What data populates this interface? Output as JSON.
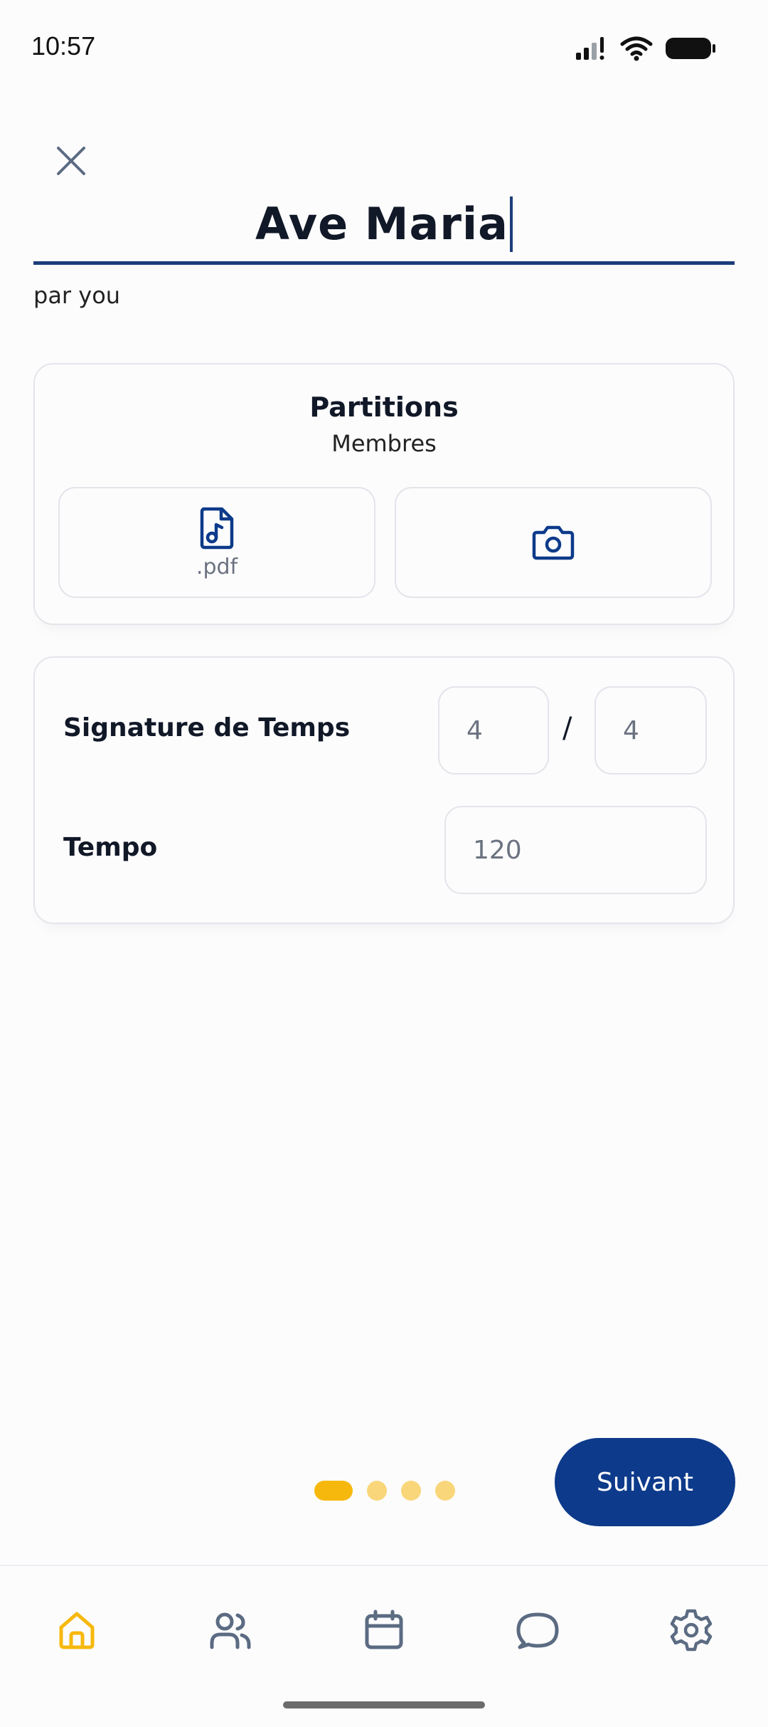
{
  "status_bar": {
    "time": "10:57"
  },
  "header": {
    "title_value": "Ave Maria",
    "author": "par you"
  },
  "sheets": {
    "title": "Partitions",
    "subtitle": "Membres",
    "pdf_label": ".pdf"
  },
  "settings": {
    "time_signature_label": "Signature de Temps",
    "time_signature_top_placeholder": "4",
    "separator": "/",
    "time_signature_bottom_placeholder": "4",
    "tempo_label": "Tempo",
    "tempo_placeholder": "120"
  },
  "pager": {
    "total_pages": 4,
    "current_page": 1
  },
  "actions": {
    "next_label": "Suivant"
  },
  "bottom_nav": {
    "items": [
      "home-icon",
      "members-icon",
      "calendar-icon",
      "chat-icon",
      "settings-icon"
    ],
    "active_index": 0
  },
  "colors": {
    "accent": "#f7b80e",
    "primary": "#0d3a8a",
    "icon_inactive": "#5b6b82"
  }
}
